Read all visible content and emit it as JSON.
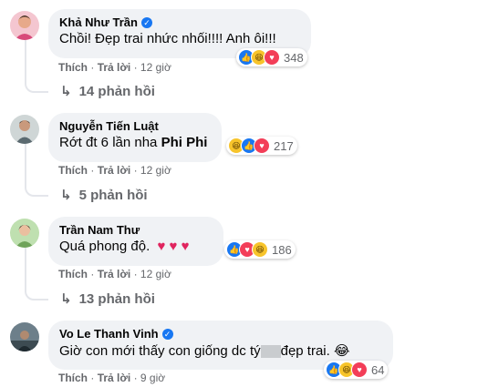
{
  "comments": [
    {
      "name": "Khả Như Trần",
      "verified": true,
      "text": "Chồi! Đẹp trai nhức nhối!!!! Anh ôi!!!",
      "reaction_count": "348",
      "like": "Thích",
      "reply": "Trả lời",
      "time": "12 giờ",
      "replies": "14 phản hồi",
      "reactions": [
        "like-icon",
        "haha-icon",
        "love-icon"
      ]
    },
    {
      "name": "Nguyễn Tiến Luật",
      "verified": false,
      "text": "Rớt đt 6 lần nha",
      "tag": "Phi Phi",
      "reaction_count": "217",
      "like": "Thích",
      "reply": "Trả lời",
      "time": "12 giờ",
      "replies": "5 phản hồi",
      "reactions": [
        "haha-icon",
        "like-icon",
        "love-icon"
      ]
    },
    {
      "name": "Trần Nam Thư",
      "verified": false,
      "text": "Quá phong độ.",
      "hearts": "♥ ♥ ♥",
      "reaction_count": "186",
      "like": "Thích",
      "reply": "Trả lời",
      "time": "12 giờ",
      "replies": "13 phản hồi",
      "reactions": [
        "like-icon",
        "love-icon",
        "haha-icon"
      ]
    },
    {
      "name": "Vo Le Thanh Vinh",
      "verified": true,
      "text_before": "Giờ con mới thấy con giống dc tý",
      "text_after": "đẹp trai.",
      "emoji": "😂",
      "reaction_count": "64",
      "like": "Thích",
      "reply": "Trả lời",
      "time": "9 giờ",
      "reactions": [
        "like-icon",
        "haha-icon",
        "love-icon"
      ]
    }
  ],
  "colors": {
    "bubble": "#f0f2f5",
    "secondary_text": "#65676b",
    "like": "#1877f2",
    "love": "#f33e58",
    "haha": "#f7c42b"
  }
}
